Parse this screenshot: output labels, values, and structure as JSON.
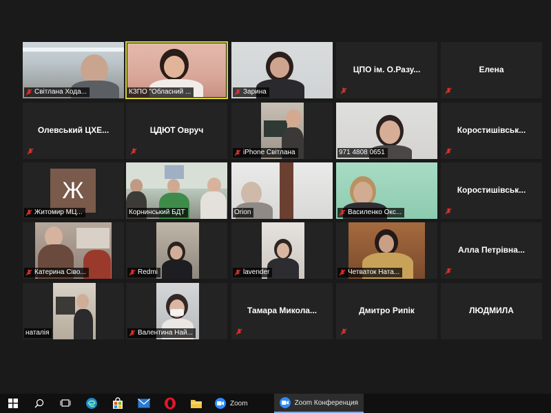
{
  "colors": {
    "background": "#1a1a1a",
    "tile": "#232323",
    "active_border": "#d6d63a",
    "mute_red": "#e0322c",
    "taskbar": "#101010",
    "zoom_blue": "#2d8cff"
  },
  "tiles": {
    "r1c1": {
      "name": "Світлана Хода...",
      "muted": true,
      "type": "video"
    },
    "r1c2": {
      "name": "КЗПО \"Обласний ...",
      "muted": false,
      "type": "video",
      "active_speaker": true
    },
    "r1c3": {
      "name": "Зарина",
      "muted": true,
      "type": "video"
    },
    "r1c4": {
      "name": "ЦПО ім. О.Разу...",
      "muted": true,
      "type": "name"
    },
    "r1c5": {
      "name": "Елена",
      "muted": true,
      "type": "name"
    },
    "r2c1": {
      "name": "Олевський ЦХЕ...",
      "muted": true,
      "type": "name"
    },
    "r2c2": {
      "name": "ЦДЮТ Овруч",
      "muted": true,
      "type": "name"
    },
    "r2c3": {
      "name": "iPhone Світлана",
      "muted": true,
      "type": "video"
    },
    "r2c4": {
      "name": "971 4808 0651",
      "muted": false,
      "type": "video"
    },
    "r2c5": {
      "name": "Коростишівськ...",
      "muted": true,
      "type": "name"
    },
    "r3c1": {
      "name": "Житомир МЦ...",
      "muted": true,
      "type": "avatar",
      "avatar_letter": "Ж"
    },
    "r3c2": {
      "name": "Корнинський БДТ",
      "muted": false,
      "type": "video"
    },
    "r3c3": {
      "name": "Orion",
      "muted": false,
      "type": "video"
    },
    "r3c4": {
      "name": "Василенко Окс...",
      "muted": true,
      "type": "video"
    },
    "r3c5": {
      "name": "Коростишівськ...",
      "muted": true,
      "type": "name"
    },
    "r4c1": {
      "name": "Катерина Сіво...",
      "muted": true,
      "type": "video"
    },
    "r4c2": {
      "name": "Redmi",
      "muted": true,
      "type": "video"
    },
    "r4c3": {
      "name": "lavender",
      "muted": true,
      "type": "video"
    },
    "r4c4": {
      "name": "Четваток Ната...",
      "muted": true,
      "type": "video"
    },
    "r4c5": {
      "name": "Алла Петрівна...",
      "muted": true,
      "type": "name"
    },
    "r5c1": {
      "name": "наталія",
      "muted": false,
      "type": "video"
    },
    "r5c2": {
      "name": "Валентина Най...",
      "muted": true,
      "type": "video"
    },
    "r5c3": {
      "name": "Тамара Микола...",
      "muted": true,
      "type": "name"
    },
    "r5c4": {
      "name": "Дмитро Рипік",
      "muted": true,
      "type": "name"
    },
    "r5c5": {
      "name": "ЛЮДМИЛА",
      "muted": false,
      "type": "name"
    }
  },
  "taskbar": {
    "icons": [
      "windows-start-icon",
      "search-icon",
      "task-view-icon",
      "edge-icon",
      "store-icon",
      "mail-icon",
      "opera-icon",
      "file-explorer-icon"
    ],
    "zoom_app_label": "Zoom",
    "zoom_meeting_label": "Zoom Конференция"
  }
}
